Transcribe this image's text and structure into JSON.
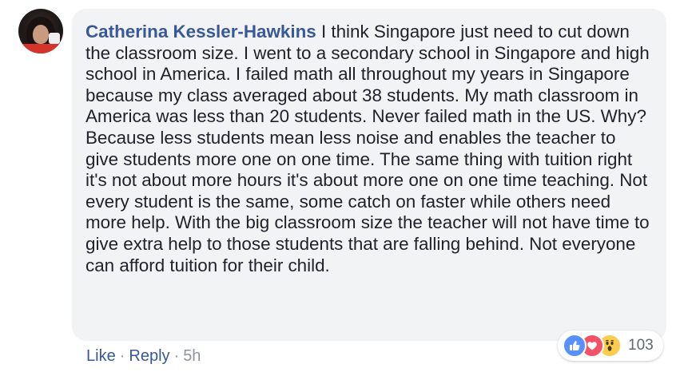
{
  "comment": {
    "author": "Catherina Kessler-Hawkins",
    "text": " I think Singapore just need to cut down the classroom size. I went to a secondary school in Singapore and high school in America. I failed math all throughout my years in Singapore because my class averaged about 38 students. My math classroom in America was less than 20 students. Never failed math in the US. Why? Because less students mean less noise and enables the teacher to give students more one on one time. The same thing with tuition right it's not about more hours it's about more one on one time teaching. Not every student is the same, some catch on faster while others need more help. With the big classroom size the teacher will not have time to give extra help to those students that are falling behind. Not everyone can afford tuition for their child."
  },
  "actions": {
    "like_label": "Like",
    "reply_label": "Reply",
    "separator": "·",
    "timestamp": "5h"
  },
  "reactions": {
    "icons": [
      "like-icon",
      "love-icon",
      "wow-icon"
    ],
    "count": "103"
  },
  "colors": {
    "author_link": "#385898",
    "bubble_bg": "#f2f3f5",
    "like_blue": "#5890ff",
    "love_red": "#f25268",
    "wow_yellow": "#fccd4d"
  }
}
